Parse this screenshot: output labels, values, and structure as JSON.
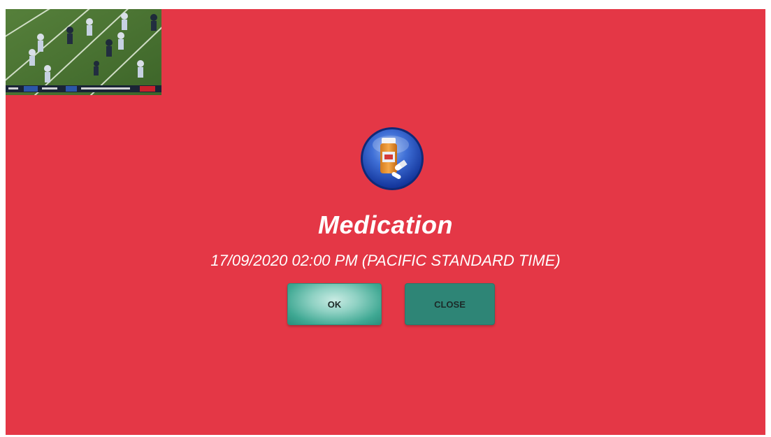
{
  "background_color": "#e43746",
  "video_preview": {
    "description_icon": "video-thumbnail"
  },
  "reminder": {
    "icon": "medication-bottle-icon",
    "title": "Medication",
    "datetime": "17/09/2020 02:00 PM (PACIFIC STANDARD TIME)"
  },
  "buttons": {
    "ok_label": "OK",
    "close_label": "CLOSE"
  },
  "colors": {
    "title_text": "#ffffff",
    "ok_button": "#5fbcaa",
    "close_button": "#2e8576"
  }
}
